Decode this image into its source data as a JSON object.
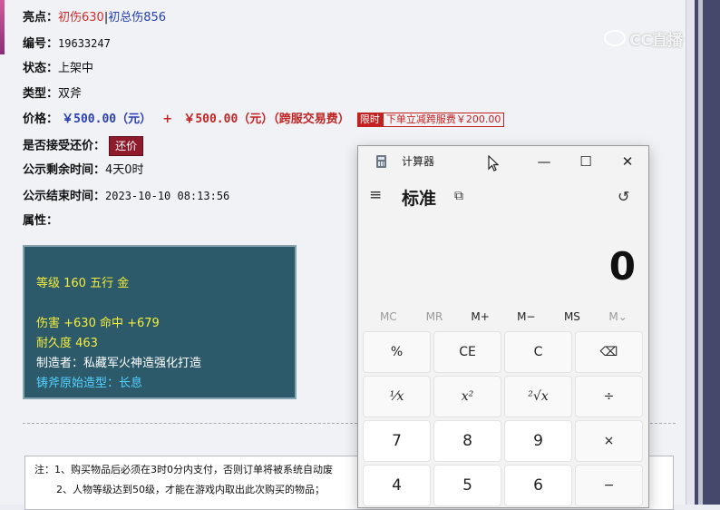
{
  "listing": {
    "highlight": {
      "label": "亮点：",
      "part1": "初伤630",
      "sep": "|",
      "part2": "初总伤856"
    },
    "serial": {
      "label": "编号：",
      "value": "19633247"
    },
    "status": {
      "label": "状态：",
      "value": "上架中"
    },
    "type": {
      "label": "类型：",
      "value": "双斧"
    },
    "price": {
      "label": "价格：",
      "amount1": "￥500.00（元）",
      "plus": "+",
      "amount2": "￥500.00（元）（跨服交易费）",
      "badge": "限时",
      "promo": "下单立减跨服费￥200.00"
    },
    "bargain": {
      "label": "是否接受还价：",
      "button": "还价"
    },
    "remaining": {
      "label": "公示剩余时间：",
      "value": "4天0时"
    },
    "end_time": {
      "label": "公示结束时间：",
      "value": "2023-10-10 08:13:56"
    },
    "attributes": {
      "label": "属性："
    },
    "attr_box": {
      "line1": "等级 160 五行 金",
      "line2": "伤害 +630 命中 +679",
      "line3": "耐久度 463",
      "line4": "制造者：私藏军火神造强化打造",
      "line5": "铸斧原始造型：长息"
    },
    "notice": {
      "line1": "注：1、购买物品后必须在3时0分内支付，否则订单将被系统自动废",
      "line2": "2、人物等级达到50级，才能在游戏内取出此次购买的物品；"
    },
    "watermark": "CC直播"
  },
  "calculator": {
    "title": "计算器",
    "controls": {
      "minimize": "—",
      "maximize": "☐",
      "close": "✕"
    },
    "menu_icon": "≡",
    "mode": "标准",
    "keep_on_top_icon": "⧉",
    "history_icon": "↺",
    "display": "0",
    "memory": [
      "MC",
      "MR",
      "M+",
      "M−",
      "MS",
      "M⌄"
    ],
    "keys": [
      "%",
      "CE",
      "C",
      "⌫",
      "¹⁄x",
      "x²",
      "²√x",
      "÷",
      "7",
      "8",
      "9",
      "×",
      "4",
      "5",
      "6",
      "−"
    ]
  }
}
